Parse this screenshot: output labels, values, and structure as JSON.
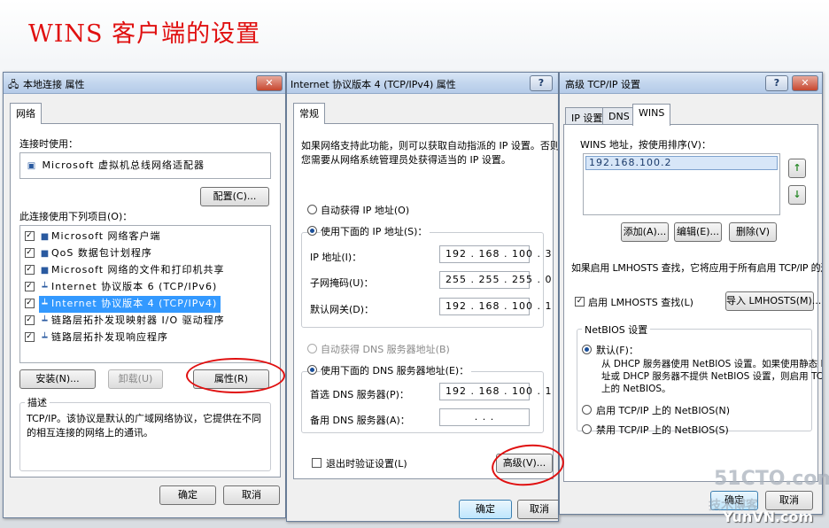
{
  "slide": {
    "title": "WINS 客户端的设置"
  },
  "dialog1": {
    "title": "本地连接 属性",
    "tab": "网络",
    "connect_using_label": "连接时使用：",
    "adapter_name": "Microsoft 虚拟机总线网络适配器",
    "configure_button": "配置(C)...",
    "items_label": "此连接使用下列项目(O)：",
    "items": [
      {
        "label": "Microsoft 网络客户端",
        "checked": true,
        "icon": "network-client-icon"
      },
      {
        "label": "QoS 数据包计划程序",
        "checked": true,
        "icon": "qos-icon"
      },
      {
        "label": "Microsoft 网络的文件和打印机共享",
        "checked": true,
        "icon": "file-share-icon"
      },
      {
        "label": "Internet 协议版本 6 (TCP/IPv6)",
        "checked": true,
        "icon": "protocol-icon"
      },
      {
        "label": "Internet 协议版本 4 (TCP/IPv4)",
        "checked": true,
        "icon": "protocol-icon",
        "selected": true
      },
      {
        "label": "链路层拓扑发现映射器 I/O 驱动程序",
        "checked": true,
        "icon": "protocol-icon"
      },
      {
        "label": "链路层拓扑发现响应程序",
        "checked": true,
        "icon": "protocol-icon"
      }
    ],
    "install_button": "安装(N)...",
    "uninstall_button": "卸载(U)",
    "properties_button": "属性(R)",
    "description_label": "描述",
    "description_line1": "TCP/IP。该协议是默认的广域网络协议，它提供在不同",
    "description_line2": "的相互连接的网络上的通讯。",
    "ok_button": "确定",
    "cancel_button": "取消"
  },
  "dialog2": {
    "title": "Internet 协议版本 4 (TCP/IPv4) 属性",
    "help_button": "?",
    "tab": "常规",
    "intro_line1": "如果网络支持此功能，则可以获取自动指派的 IP 设置。否则，",
    "intro_line2": "您需要从网络系统管理员处获得适当的 IP 设置。",
    "auto_ip_label": "自动获得 IP 地址(O)",
    "manual_ip_label": "使用下面的 IP 地址(S)：",
    "ip_label": "IP 地址(I)：",
    "ip_value": "192 . 168 . 100 . 3",
    "mask_label": "子网掩码(U)：",
    "mask_value": "255 . 255 . 255 . 0",
    "gateway_label": "默认网关(D)：",
    "gateway_value": "192 . 168 . 100 . 1",
    "auto_dns_label": "自动获得 DNS 服务器地址(B)",
    "manual_dns_label": "使用下面的 DNS 服务器地址(E)：",
    "pref_dns_label": "首选 DNS 服务器(P)：",
    "pref_dns_value": "192 . 168 . 100 . 1",
    "alt_dns_label": "备用 DNS 服务器(A)：",
    "alt_dns_value": ".   .   .",
    "validate_label": "退出时验证设置(L)",
    "advanced_button": "高级(V)...",
    "ok_button": "确定",
    "cancel_button": "取消"
  },
  "dialog3": {
    "title": "高级 TCP/IP 设置",
    "help_button": "?",
    "tabs": [
      "IP 设置",
      "DNS",
      "WINS"
    ],
    "wins_list_label": "WINS 地址，按使用排序(V)：",
    "wins_entries": [
      "192.168.100.2"
    ],
    "add_button": "添加(A)...",
    "edit_button": "编辑(E)...",
    "remove_button": "删除(V)",
    "lmhosts_info": "如果启用 LMHOSTS 查找，它将应用于所有启用 TCP/IP 的连接。",
    "lmhosts_checkbox_label": "启用 LMHOSTS 查找(L)",
    "import_button": "导入 LMHOSTS(M)...",
    "netbios_group_label": "NetBIOS 设置",
    "netbios_default_label": "默认(F)：",
    "netbios_default_desc1": "从 DHCP 服务器使用 NetBIOS 设置。如果使用静态 IP 地",
    "netbios_default_desc2": "址或 DHCP 服务器不提供 NetBIOS 设置，则启用 TCP/IP",
    "netbios_default_desc3": "上的 NetBIOS。",
    "netbios_enable_label": "启用 TCP/IP 上的 NetBIOS(N)",
    "netbios_disable_label": "禁用 TCP/IP 上的 NetBIOS(S)",
    "ok_button": "确定",
    "cancel_button": "取消"
  },
  "watermark": {
    "site": "51CTO.com",
    "site2": "技术博客",
    "site3": "YunVN.com"
  },
  "colors": {
    "title_red": "#e01010",
    "annotation_red": "#e01010",
    "selection_blue": "#3399ff"
  }
}
